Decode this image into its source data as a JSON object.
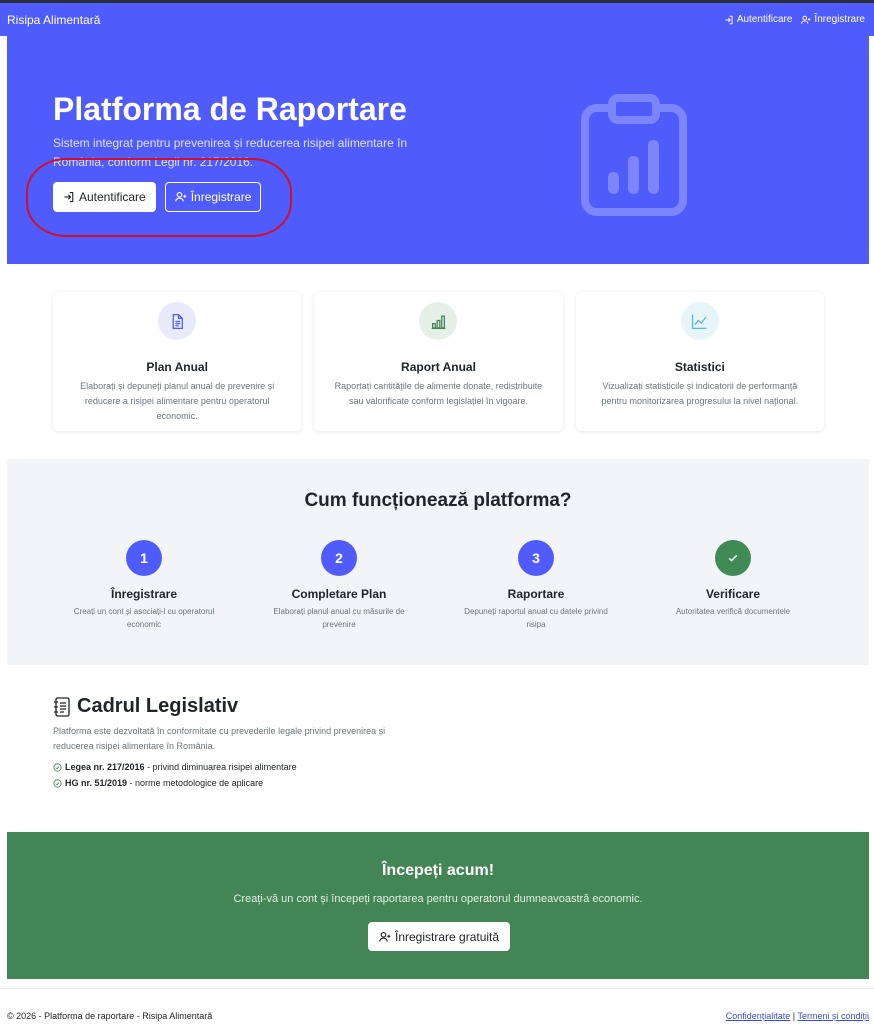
{
  "colors": {
    "primary": "#4f5bfa",
    "success": "#438554",
    "step_check": "#3f8a55",
    "annotation": "#d0102a"
  },
  "navbar": {
    "brand": "Risipa Alimentară",
    "login_label": "Autentificare",
    "register_label": "Înregistrare",
    "login_icon": "login-icon",
    "register_icon": "person-add-icon"
  },
  "hero": {
    "title": "Platforma de Raportare",
    "subtitle": "Sistem integrat pentru prevenirea și reducerea risipei alimentare în România, conform Legii nr. 217/2016.",
    "login_button": "Autentificare",
    "register_button": "Înregistrare",
    "illustration_icon": "clipboard-chart-icon"
  },
  "features": [
    {
      "title": "Plan Anual",
      "description": "Elaborați și depuneți planul anual de prevenire și reducere a risipei alimentare pentru operatorul economic.",
      "icon": "document-icon",
      "icon_color": "#4f5bfa",
      "bg_color": "#e9ebfd"
    },
    {
      "title": "Raport Anual",
      "description": "Raportați cantitățile de alimente donate, redistribuite sau valorificate conform legislației în vigoare.",
      "icon": "bar-chart-icon",
      "icon_color": "#438554",
      "bg_color": "#e6f0e9"
    },
    {
      "title": "Statistici",
      "description": "Vizualizați statisticile și indicatorii de performanță pentru monitorizarea progresului la nivel național.",
      "icon": "line-chart-icon",
      "icon_color": "#5bb9d8",
      "bg_color": "#e6f5fa"
    }
  ],
  "how_it_works": {
    "title": "Cum funcționează platforma?",
    "steps": [
      {
        "number": "1",
        "title": "Înregistrare",
        "description": "Creați un cont și asociați-l cu operatorul economic"
      },
      {
        "number": "2",
        "title": "Completare Plan",
        "description": "Elaborați planul anual cu măsurile de prevenire"
      },
      {
        "number": "3",
        "title": "Raportare",
        "description": "Depuneți raportul anual cu datele privind risipa"
      },
      {
        "number": "",
        "title": "Verificare",
        "description": "Autoritatea verifică documentele",
        "icon": "check-icon"
      }
    ]
  },
  "legal": {
    "title": "Cadrul Legislativ",
    "icon": "journal-text-icon",
    "text": "Platforma este dezvoltată în conformitate cu prevederile legale privind prevenirea și reducerea risipei alimentare în România.",
    "laws": [
      {
        "name": "Legea nr. 217/2016",
        "description": " - privind diminuarea risipei alimentare"
      },
      {
        "name": "HG nr. 51/2019",
        "description": " - norme metodologice de aplicare"
      }
    ]
  },
  "cta": {
    "title": "Începeți acum!",
    "text": "Creați-vă un cont și începeți raportarea pentru operatorul dumneavoastră economic.",
    "button": "Înregistrare gratuită"
  },
  "footer": {
    "copyright": "© 2026 - Platforma de raportare - Risipa Alimentară",
    "privacy": "Confidențialitate",
    "separator": "|",
    "terms": "Termeni și condiții"
  }
}
